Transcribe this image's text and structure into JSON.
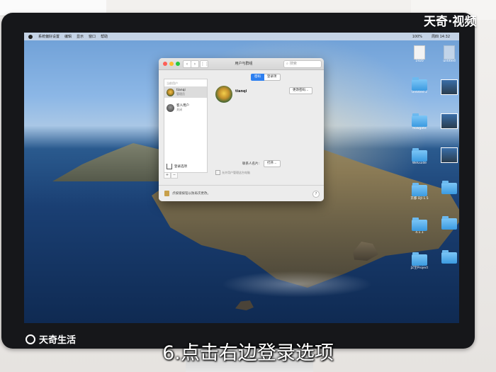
{
  "menubar": {
    "items": [
      "系统偏好设置",
      "编辑",
      "显示",
      "窗口",
      "帮助"
    ],
    "status": [
      "100%",
      "周四 14:32"
    ]
  },
  "window": {
    "title": "用户与群组",
    "search_placeholder": "搜索",
    "sidebar": {
      "section_current": "当前用户",
      "users": [
        {
          "name": "tianqi",
          "role": "管理员"
        },
        {
          "name": "客人用户",
          "role": "关闭"
        }
      ],
      "login_options": "登录选项"
    },
    "tabs": [
      "密码",
      "登录项"
    ],
    "user_name": "tianqi",
    "change_password_button": "更改密码…",
    "contact_card_label": "联系人名片:",
    "open_button": "打开…",
    "allow_admin_label": "允许用户管理这台电脑",
    "lock_text": "点按锁按钮以防再次更改。",
    "help": "?"
  },
  "desktop_icons": [
    {
      "label": "1920"
    },
    {
      "label": "untitled"
    },
    {
      "label": "Untitled 2"
    },
    {
      "label": "flowgate"
    },
    {
      "label": "WeGuide"
    },
    {
      "label": "京都 DJI 1.5"
    },
    {
      "label": "4.1.1"
    },
    {
      "label": "JZ至Project"
    }
  ],
  "watermark": "天奇·视频",
  "logo_text": "天奇生活",
  "caption": "6.点击右边登录选项"
}
